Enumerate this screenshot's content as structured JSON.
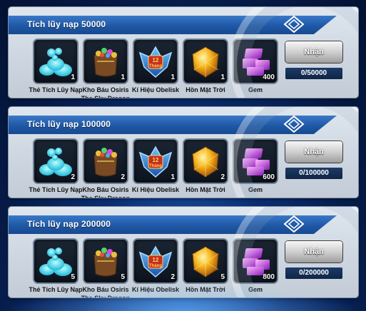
{
  "tiers": [
    {
      "title": "Tích lũy nạp 50000",
      "claim_label": "Nhận",
      "progress": "0/50000",
      "rewards": [
        {
          "icon": "the-tich-luy-nap-icon",
          "name": "Thẻ Tích Lũy Nạp",
          "qty": "1"
        },
        {
          "icon": "treasure-bag-icon",
          "name": "Kho Báu Osiris The Sky Dragon",
          "qty": "1"
        },
        {
          "icon": "obelisk-emblem-icon",
          "name": "Kí Hiệu Obelisk",
          "qty": "1",
          "badge": "12\nTháng"
        },
        {
          "icon": "sun-soul-icon",
          "name": "Hồn Mặt Trời",
          "qty": "1"
        },
        {
          "icon": "gem-icon",
          "name": "Gem",
          "qty": "400"
        }
      ]
    },
    {
      "title": "Tích lũy nạp 100000",
      "claim_label": "Nhận",
      "progress": "0/100000",
      "rewards": [
        {
          "icon": "the-tich-luy-nap-icon",
          "name": "Thẻ Tích Lũy Nạp",
          "qty": "2"
        },
        {
          "icon": "treasure-bag-icon",
          "name": "Kho Báu Osiris The Sky Dragon",
          "qty": "2"
        },
        {
          "icon": "obelisk-emblem-icon",
          "name": "Kí Hiệu Obelisk",
          "qty": "1",
          "badge": "12\nTháng"
        },
        {
          "icon": "sun-soul-icon",
          "name": "Hồn Mặt Trời",
          "qty": "2"
        },
        {
          "icon": "gem-icon",
          "name": "Gem",
          "qty": "600"
        }
      ]
    },
    {
      "title": "Tích lũy nạp 200000",
      "claim_label": "Nhận",
      "progress": "0/200000",
      "rewards": [
        {
          "icon": "the-tich-luy-nap-icon",
          "name": "Thẻ Tích Lũy Nạp",
          "qty": "5"
        },
        {
          "icon": "treasure-bag-icon",
          "name": "Kho Báu Osiris The Sky Dragon",
          "qty": "5"
        },
        {
          "icon": "obelisk-emblem-icon",
          "name": "Kí Hiệu Obelisk",
          "qty": "2",
          "badge": "12\nTháng"
        },
        {
          "icon": "sun-soul-icon",
          "name": "Hồn Mặt Trời",
          "qty": "5"
        },
        {
          "icon": "gem-icon",
          "name": "Gem",
          "qty": "800"
        }
      ]
    }
  ],
  "colors": {
    "header": "#1f58a6",
    "panel": "#cfd8e2",
    "progress_bg": "#0f2547",
    "background": "#0b2f74"
  }
}
